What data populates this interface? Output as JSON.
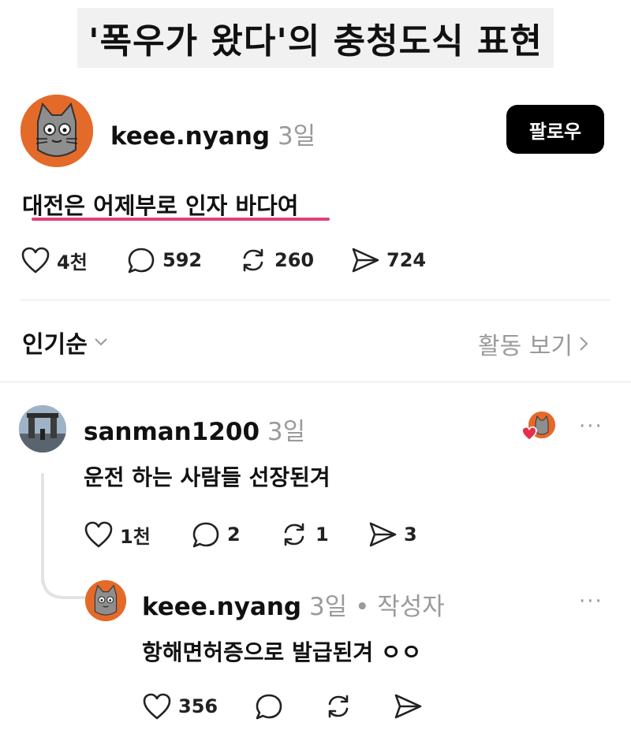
{
  "title": "'폭우가 왔다'의 충청도식 표현",
  "post": {
    "username": "keee.nyang",
    "time": "3일",
    "follow_label": "팔로우",
    "text": "대전은 어제부로 인자 바다여",
    "likes": "4천",
    "comments": "592",
    "reposts": "260",
    "shares": "724"
  },
  "sort_label": "인기순",
  "activity_label": "활동 보기",
  "comment1": {
    "username": "sanman1200",
    "time": "3일",
    "text": "운전 하는 사람들 선장된겨",
    "likes": "1천",
    "comments": "2",
    "reposts": "1",
    "shares": "3",
    "more": "···"
  },
  "reply": {
    "username": "keee.nyang",
    "time": "3일",
    "author_tag": "• 작성자",
    "text": "항해면허증으로 발급된겨 ㅇㅇ",
    "likes": "356",
    "more": "···"
  },
  "colors": {
    "accent_underline": "#e0407a",
    "avatar_orange": "#e46a2a",
    "heart_red": "#e5304a"
  }
}
